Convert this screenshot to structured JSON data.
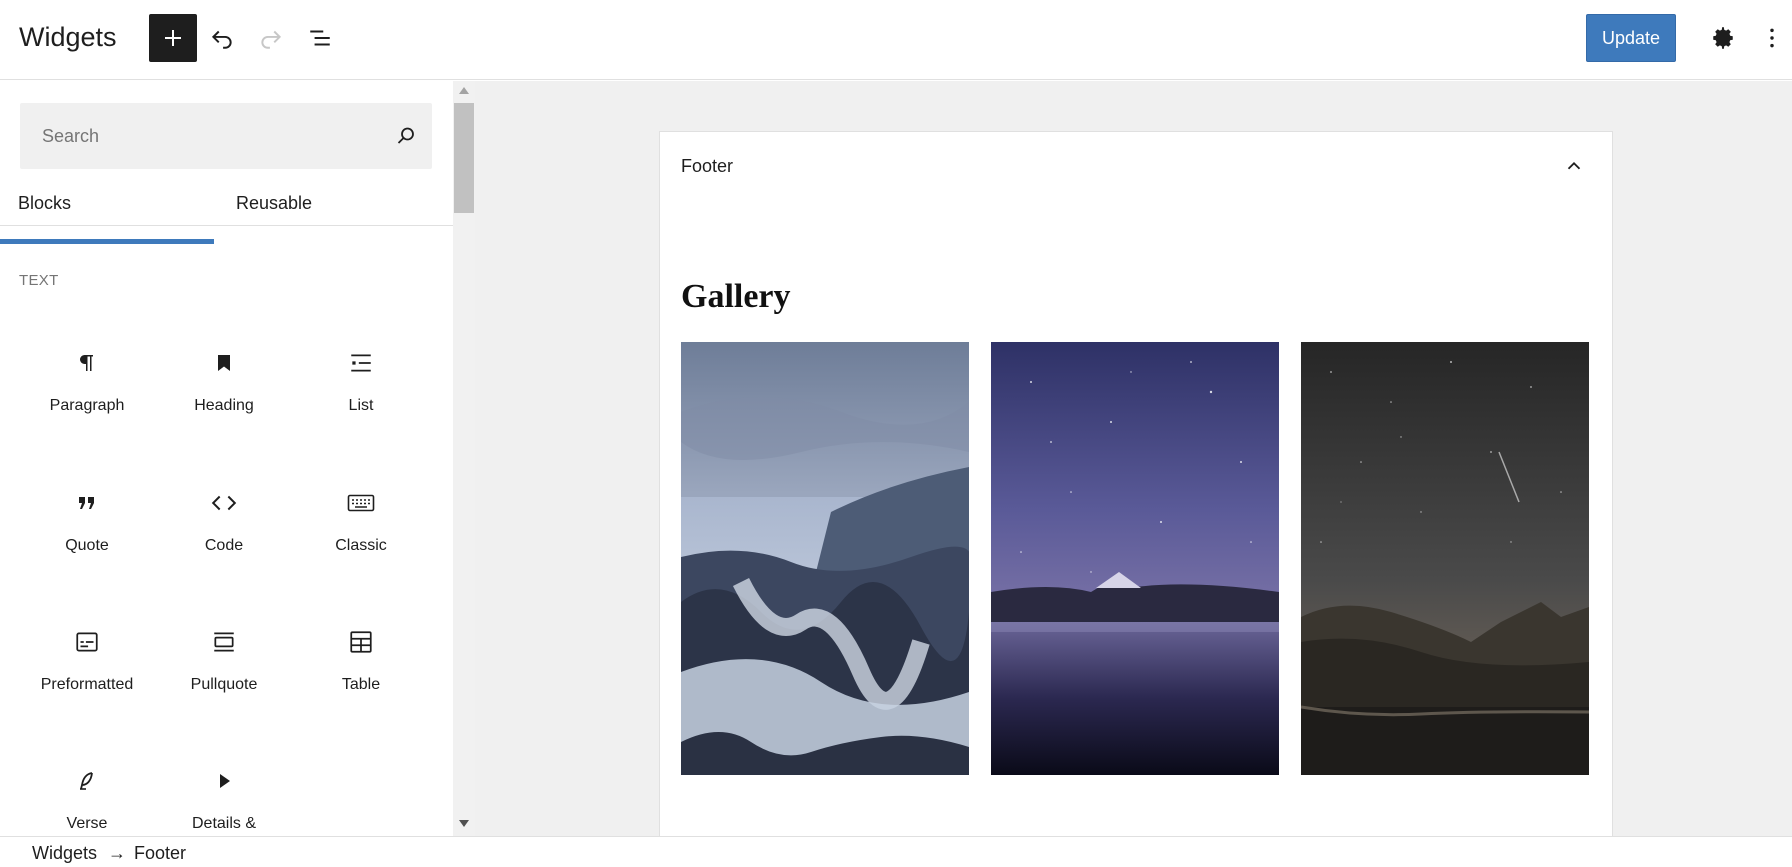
{
  "header": {
    "title": "Widgets",
    "update_label": "Update"
  },
  "sidebar": {
    "search_placeholder": "Search",
    "tabs": [
      {
        "label": "Blocks",
        "active": true
      },
      {
        "label": "Reusable",
        "active": false
      }
    ],
    "category": "TEXT",
    "blocks": [
      {
        "label": "Paragraph",
        "icon": "paragraph-icon"
      },
      {
        "label": "Heading",
        "icon": "heading-icon"
      },
      {
        "label": "List",
        "icon": "list-icon"
      },
      {
        "label": "Quote",
        "icon": "quote-icon"
      },
      {
        "label": "Code",
        "icon": "code-icon"
      },
      {
        "label": "Classic",
        "icon": "keyboard-icon"
      },
      {
        "label": "Preformatted",
        "icon": "preformatted-icon"
      },
      {
        "label": "Pullquote",
        "icon": "pullquote-icon"
      },
      {
        "label": "Table",
        "icon": "table-icon"
      },
      {
        "label": "Verse",
        "icon": "feather-icon"
      },
      {
        "label": "Details &",
        "icon": "details-icon"
      }
    ]
  },
  "canvas": {
    "area_title": "Footer",
    "gallery_heading": "Gallery",
    "images": [
      {
        "name": "seascape-rocks"
      },
      {
        "name": "night-lake-mountain"
      },
      {
        "name": "starry-valley-lake"
      }
    ]
  },
  "breadcrumb": {
    "items": [
      "Widgets",
      "Footer"
    ],
    "separator": "→"
  },
  "colors": {
    "accent": "#3e7abc",
    "dark": "#1e1e1e",
    "canvas_bg": "#f0f0f0"
  }
}
